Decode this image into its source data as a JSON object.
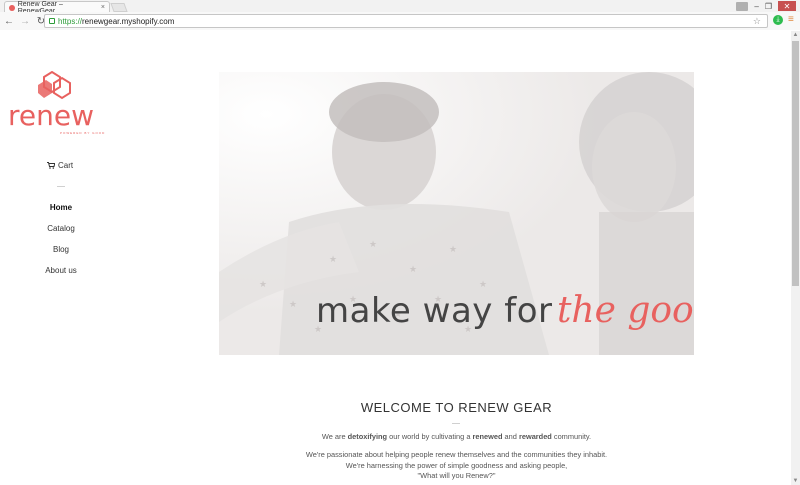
{
  "browser": {
    "tab_title": "Renew Gear – RenewGear",
    "tab_close": "×",
    "url_scheme": "https://",
    "url_host": "renewgear.myshopify.com",
    "window_controls": {
      "minimize": "–",
      "restore": "❐",
      "close": "✕"
    }
  },
  "site": {
    "brand": "renew",
    "brand_tagline": "POWERED BY GOOD",
    "brand_color": "#e8615f",
    "cart_label": "Cart",
    "nav": [
      {
        "label": "Home",
        "active": true
      },
      {
        "label": "Catalog",
        "active": false
      },
      {
        "label": "Blog",
        "active": false
      },
      {
        "label": "About us",
        "active": false
      }
    ]
  },
  "hero": {
    "headline_plain": "make way for",
    "headline_script": "the good."
  },
  "welcome": {
    "heading": "WELCOME TO RENEW GEAR",
    "intro_prefix": "We are ",
    "intro_bold1": "detoxifying",
    "intro_mid": " our world by cultivating a ",
    "intro_bold2": "renewed",
    "intro_and": " and ",
    "intro_bold3": "rewarded",
    "intro_suffix": " community.",
    "lines": [
      "We're passionate about helping people renew themselves and the communities they inhabit.",
      "We're harnessing the power of simple goodness and asking people,",
      "\"What will you Renew?\""
    ]
  }
}
